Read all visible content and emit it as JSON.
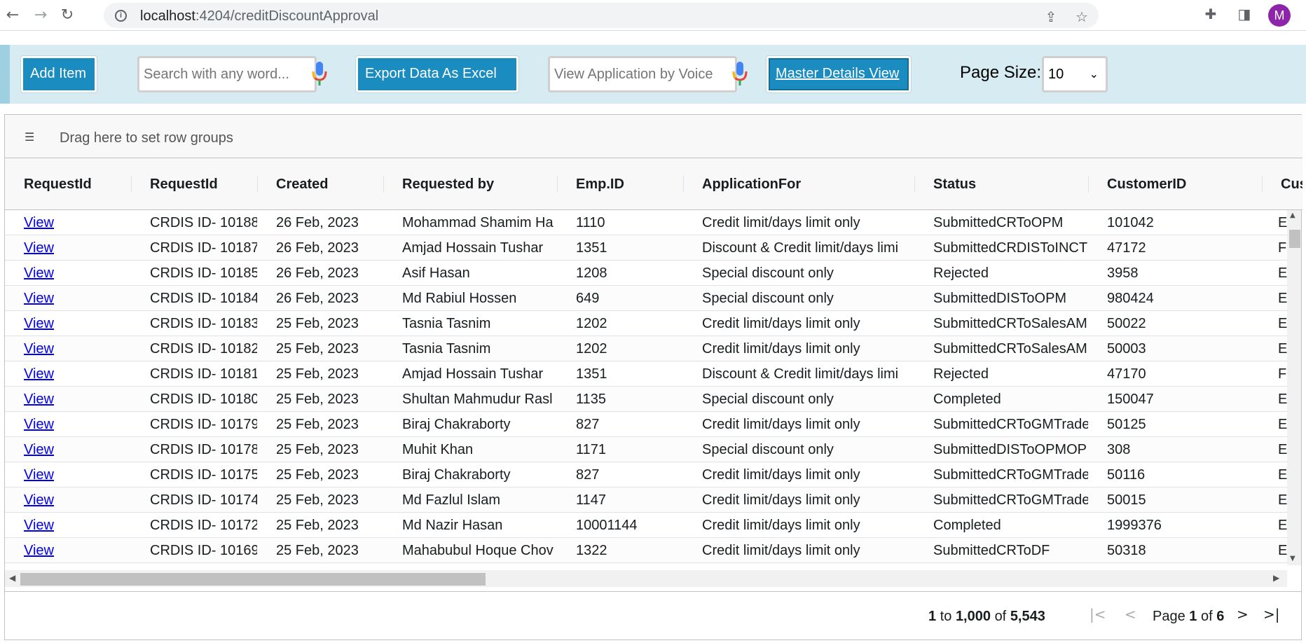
{
  "browser": {
    "url_host": "localhost",
    "url_path": ":4204/creditDiscountApproval",
    "avatar_letter": "M"
  },
  "toolbar": {
    "add_item_label": "Add Item",
    "search_placeholder": "Search with any word...",
    "export_label": "Export Data As Excel",
    "voice_placeholder": "View Application by Voice",
    "master_details_label": "Master Details View",
    "page_size_label": "Page Size:",
    "page_size_value": "10"
  },
  "grid": {
    "group_bar_text": "Drag here to set row groups",
    "columns": [
      "RequestId",
      "RequestId",
      "Created",
      "Requested by",
      "Emp.ID",
      "ApplicationFor",
      "Status",
      "CustomerID",
      "Cus"
    ],
    "rows": [
      {
        "link": "View",
        "request_id": "CRDIS ID- 10188",
        "created": "26 Feb, 2023",
        "requested_by": "Mohammad Shamim Ha",
        "emp_id": "1110",
        "application_for": "Credit limit/days limit only",
        "status": "SubmittedCRToOPM",
        "customer_id": "101042",
        "cus": "E"
      },
      {
        "link": "View",
        "request_id": "CRDIS ID- 10187",
        "created": "26 Feb, 2023",
        "requested_by": "Amjad Hossain Tushar",
        "emp_id": "1351",
        "application_for": "Discount & Credit limit/days limi",
        "status": "SubmittedCRDISToINCT",
        "customer_id": "47172",
        "cus": "F"
      },
      {
        "link": "View",
        "request_id": "CRDIS ID- 10185",
        "created": "26 Feb, 2023",
        "requested_by": "Asif Hasan",
        "emp_id": "1208",
        "application_for": "Special discount only",
        "status": "Rejected",
        "customer_id": "3958",
        "cus": "E"
      },
      {
        "link": "View",
        "request_id": "CRDIS ID- 10184",
        "created": "26 Feb, 2023",
        "requested_by": "Md Rabiul Hossen",
        "emp_id": "649",
        "application_for": "Special discount only",
        "status": "SubmittedDISToOPM",
        "customer_id": "980424",
        "cus": "E"
      },
      {
        "link": "View",
        "request_id": "CRDIS ID- 10183",
        "created": "25 Feb, 2023",
        "requested_by": "Tasnia Tasnim",
        "emp_id": "1202",
        "application_for": "Credit limit/days limit only",
        "status": "SubmittedCRToSalesAM",
        "customer_id": "50022",
        "cus": "E"
      },
      {
        "link": "View",
        "request_id": "CRDIS ID- 10182",
        "created": "25 Feb, 2023",
        "requested_by": "Tasnia Tasnim",
        "emp_id": "1202",
        "application_for": "Credit limit/days limit only",
        "status": "SubmittedCRToSalesAM",
        "customer_id": "50003",
        "cus": "E"
      },
      {
        "link": "View",
        "request_id": "CRDIS ID- 10181",
        "created": "25 Feb, 2023",
        "requested_by": "Amjad Hossain Tushar",
        "emp_id": "1351",
        "application_for": "Discount & Credit limit/days limi",
        "status": "Rejected",
        "customer_id": "47170",
        "cus": "F"
      },
      {
        "link": "View",
        "request_id": "CRDIS ID- 10180",
        "created": "25 Feb, 2023",
        "requested_by": "Shultan Mahmudur Rasl",
        "emp_id": "1135",
        "application_for": "Special discount only",
        "status": "Completed",
        "customer_id": "150047",
        "cus": "E"
      },
      {
        "link": "View",
        "request_id": "CRDIS ID- 10179",
        "created": "25 Feb, 2023",
        "requested_by": "Biraj Chakraborty",
        "emp_id": "827",
        "application_for": "Credit limit/days limit only",
        "status": "SubmittedCRToGMTrade",
        "customer_id": "50125",
        "cus": "E"
      },
      {
        "link": "View",
        "request_id": "CRDIS ID- 10178",
        "created": "25 Feb, 2023",
        "requested_by": "Muhit Khan",
        "emp_id": "1171",
        "application_for": "Special discount only",
        "status": "SubmittedDISToOPMOP",
        "customer_id": "308",
        "cus": "E"
      },
      {
        "link": "View",
        "request_id": "CRDIS ID- 10175",
        "created": "25 Feb, 2023",
        "requested_by": "Biraj Chakraborty",
        "emp_id": "827",
        "application_for": "Credit limit/days limit only",
        "status": "SubmittedCRToGMTrade",
        "customer_id": "50116",
        "cus": "E"
      },
      {
        "link": "View",
        "request_id": "CRDIS ID- 10174",
        "created": "25 Feb, 2023",
        "requested_by": "Md Fazlul Islam",
        "emp_id": "1147",
        "application_for": "Credit limit/days limit only",
        "status": "SubmittedCRToGMTrade",
        "customer_id": "50015",
        "cus": "E"
      },
      {
        "link": "View",
        "request_id": "CRDIS ID- 10172",
        "created": "25 Feb, 2023",
        "requested_by": "Md Nazir Hasan",
        "emp_id": "10001144",
        "application_for": "Credit limit/days limit only",
        "status": "Completed",
        "customer_id": "1999376",
        "cus": "E"
      },
      {
        "link": "View",
        "request_id": "CRDIS ID- 10169",
        "created": "25 Feb, 2023",
        "requested_by": "Mahabubul Hoque Chov",
        "emp_id": "1322",
        "application_for": "Credit limit/days limit only",
        "status": "SubmittedCRToDF",
        "customer_id": "50318",
        "cus": "E"
      }
    ]
  },
  "paging": {
    "row_from": "1",
    "to_word": "to",
    "row_to": "1,000",
    "of_word": "of",
    "row_total": "5,543",
    "page_word": "Page",
    "page_current": "1",
    "page_of_word": "of",
    "page_total": "6"
  },
  "colors": {
    "toolbar_bg": "#d7ebf3",
    "button_bg": "#1a8cc0",
    "avatar_bg": "#8e24aa",
    "link": "#0000ee"
  },
  "icons": [
    "back-arrow-icon",
    "forward-arrow-icon",
    "reload-icon",
    "info-icon",
    "share-icon",
    "star-icon",
    "extensions-icon",
    "side-panel-icon",
    "mic-icon",
    "row-group-icon",
    "first-page-icon",
    "previous-page-icon",
    "next-page-icon",
    "last-page-icon"
  ]
}
